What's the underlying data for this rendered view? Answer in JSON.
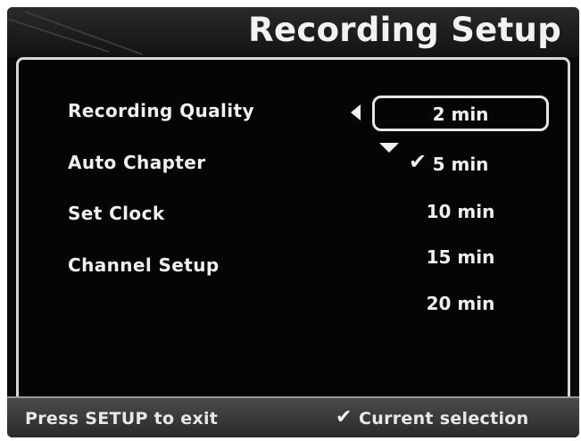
{
  "header": {
    "title": "Recording Setup"
  },
  "menu": {
    "items": [
      {
        "label": "Recording Quality"
      },
      {
        "label": "Auto Chapter"
      },
      {
        "label": "Set Clock"
      },
      {
        "label": "Channel Setup"
      }
    ]
  },
  "options": {
    "highlighted": "2 min",
    "current": "5 min",
    "items": [
      "2 min",
      "5 min",
      "10 min",
      "15 min",
      "20 min"
    ]
  },
  "footer": {
    "exit_hint": "Press SETUP to exit",
    "legend_label": "Current selection"
  },
  "icons": {
    "left": "triangle-left-icon",
    "down": "triangle-down-icon",
    "check": "check-mark-icon"
  }
}
